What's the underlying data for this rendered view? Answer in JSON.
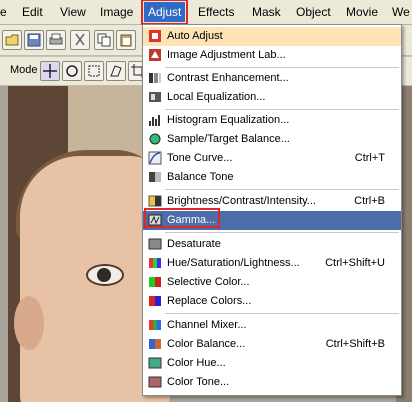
{
  "menubar": {
    "items": [
      {
        "label": "e"
      },
      {
        "label": "Edit"
      },
      {
        "label": "View"
      },
      {
        "label": "Image"
      },
      {
        "label": "Adjust"
      },
      {
        "label": "Effects"
      },
      {
        "label": "Mask"
      },
      {
        "label": "Object"
      },
      {
        "label": "Movie"
      },
      {
        "label": "We"
      }
    ],
    "active": "Adjust"
  },
  "toolbar2": {
    "mode_label": "Mode"
  },
  "adjust_menu": {
    "items": [
      {
        "label": "Auto Adjust",
        "shortcut": ""
      },
      {
        "label": "Image Adjustment Lab...",
        "shortcut": ""
      },
      {
        "label": "Contrast Enhancement...",
        "shortcut": ""
      },
      {
        "label": "Local Equalization...",
        "shortcut": ""
      },
      {
        "label": "Histogram Equalization...",
        "shortcut": ""
      },
      {
        "label": "Sample/Target Balance...",
        "shortcut": ""
      },
      {
        "label": "Tone Curve...",
        "shortcut": "Ctrl+T"
      },
      {
        "label": "Balance Tone",
        "shortcut": ""
      },
      {
        "label": "Brightness/Contrast/Intensity...",
        "shortcut": "Ctrl+B"
      },
      {
        "label": "Gamma...",
        "shortcut": ""
      },
      {
        "label": "Desaturate",
        "shortcut": ""
      },
      {
        "label": "Hue/Saturation/Lightness...",
        "shortcut": "Ctrl+Shift+U"
      },
      {
        "label": "Selective Color...",
        "shortcut": ""
      },
      {
        "label": "Replace Colors...",
        "shortcut": ""
      },
      {
        "label": "Channel Mixer...",
        "shortcut": ""
      },
      {
        "label": "Color Balance...",
        "shortcut": "Ctrl+Shift+B"
      },
      {
        "label": "Color Hue...",
        "shortcut": ""
      },
      {
        "label": "Color Tone...",
        "shortcut": ""
      }
    ],
    "highlighted": "Gamma..."
  },
  "colors": {
    "menu_active_bg": "#316ac5",
    "highlight_bg": "#4b6da8",
    "annotation_red": "#e0262a",
    "first_item_bg": "#fde3b5"
  }
}
